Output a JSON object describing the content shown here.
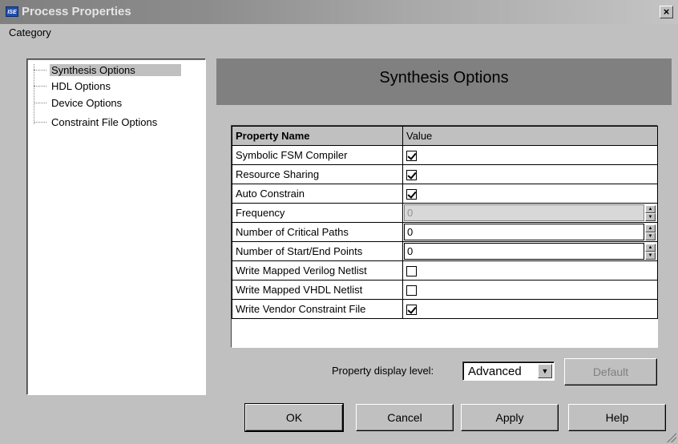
{
  "window": {
    "title": "Process Properties",
    "icon_text": "ISE",
    "close_label": "×"
  },
  "category": {
    "label": "Category",
    "items": [
      {
        "label": "Synthesis Options",
        "selected": true
      },
      {
        "label": "HDL Options",
        "selected": false
      },
      {
        "label": "Device Options",
        "selected": false
      },
      {
        "label": "Constraint File Options",
        "selected": false
      }
    ]
  },
  "panel": {
    "header": "Synthesis Options"
  },
  "grid": {
    "col_name": "Property Name",
    "col_value": "Value",
    "rows": [
      {
        "name": "Symbolic FSM Compiler",
        "type": "checkbox",
        "checked": true
      },
      {
        "name": "Resource Sharing",
        "type": "checkbox",
        "checked": true
      },
      {
        "name": "Auto Constrain",
        "type": "checkbox",
        "checked": true
      },
      {
        "name": "Frequency",
        "type": "spin",
        "value": "0",
        "disabled": true
      },
      {
        "name": "Number of Critical Paths",
        "type": "spin",
        "value": "0",
        "disabled": false
      },
      {
        "name": "Number of Start/End Points",
        "type": "spin",
        "value": "0",
        "disabled": false
      },
      {
        "name": "Write Mapped Verilog Netlist",
        "type": "checkbox",
        "checked": false
      },
      {
        "name": "Write Mapped VHDL Netlist",
        "type": "checkbox",
        "checked": false
      },
      {
        "name": "Write Vendor Constraint File",
        "type": "checkbox",
        "checked": true
      }
    ]
  },
  "display_level": {
    "label": "Property display level:",
    "value": "Advanced",
    "default_label": "Default"
  },
  "buttons": {
    "ok": "OK",
    "cancel": "Cancel",
    "apply": "Apply",
    "help": "Help"
  }
}
